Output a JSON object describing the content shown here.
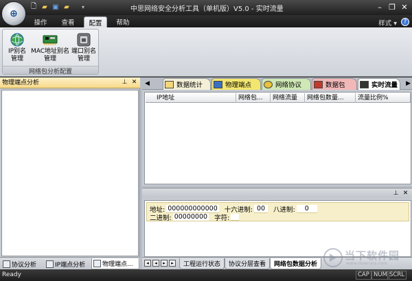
{
  "window": {
    "title": "中思网络安全分析工具（单机版）V5.0 - 实时流量",
    "buttons": [
      "–",
      "❐",
      "✕"
    ]
  },
  "ribbon": {
    "tabs": [
      {
        "label": "操作"
      },
      {
        "label": "查看"
      },
      {
        "label": "配置",
        "active": true
      },
      {
        "label": "帮助"
      }
    ],
    "style_label": "样式",
    "help_label": "?",
    "group_label": "网络包分析配置",
    "buttons": [
      {
        "label1": "IP别名",
        "label2": "管理",
        "icon": "globe-icon"
      },
      {
        "label1": "MAC地址别名",
        "label2": "管理",
        "icon": "network-card-icon"
      },
      {
        "label1": "端口别名",
        "label2": "管理",
        "icon": "port-icon"
      }
    ]
  },
  "left_panel": {
    "title": "物理端点分析",
    "pin_icon": "pin-icon",
    "close_icon": "close-icon",
    "tabs": [
      {
        "label": "协议分析",
        "icon": "protocol-icon"
      },
      {
        "label": "IP端点分析",
        "icon": "ip-endpoint-icon"
      },
      {
        "label": "物理端点...",
        "icon": "physical-endpoint-icon",
        "active": true
      }
    ]
  },
  "doc_tabs": [
    {
      "label": "数据统计",
      "icon": "folder-icon",
      "color": "#f4f0d8"
    },
    {
      "label": "物理端点",
      "icon": "physical-endpoint-icon",
      "color": "#f3e66f"
    },
    {
      "label": "网络协议",
      "icon": "protocol-icon",
      "color": "#cfe8b5"
    },
    {
      "label": "数据包",
      "icon": "packet-icon",
      "color": "#f2b8b8"
    },
    {
      "label": "实时流量",
      "icon": "traffic-icon",
      "color": "#ffffff",
      "active": true
    }
  ],
  "grid": {
    "columns": [
      "IP地址",
      "网络包...",
      "网络流量",
      "网络包数量...",
      "流量比例%"
    ]
  },
  "hex": {
    "address_label": "地址:",
    "address_value": "000000000000",
    "hex_label": "十六进制:",
    "hex_value": "00",
    "oct_label": "八进制:",
    "oct_value": "0",
    "bin_label": "二进制:",
    "bin_value": "00000000",
    "char_label": "字符:",
    "char_value": ""
  },
  "bottom_tabs": [
    {
      "label": "工程运行状态"
    },
    {
      "label": "协议分层查看"
    },
    {
      "label": "网络包数据分析",
      "active": true
    }
  ],
  "status": {
    "text": "Ready",
    "indicators": [
      "CAP",
      "NUM",
      "SCRL"
    ]
  },
  "watermark": {
    "text": "当下软件园",
    "sub": "www.downxia.com"
  }
}
